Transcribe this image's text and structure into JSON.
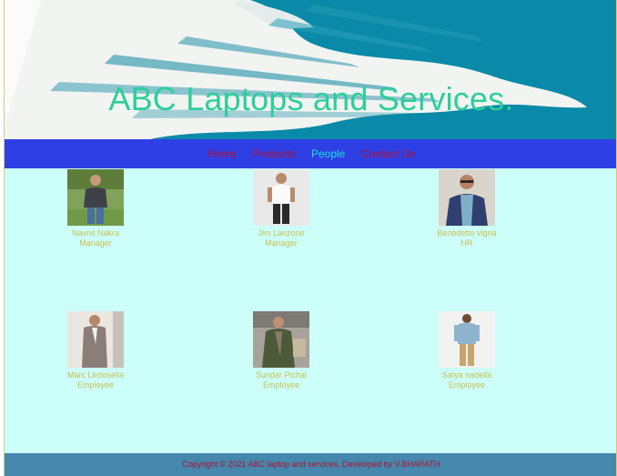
{
  "site": {
    "title": "ABC Laptops and Services."
  },
  "nav": {
    "items": [
      {
        "label": "Home"
      },
      {
        "label": "Products"
      },
      {
        "label": "People"
      },
      {
        "label": "Contact Us"
      }
    ],
    "active": "People"
  },
  "people": [
    {
      "name": "Navnit Nakra",
      "role": "Manager",
      "photo_icon": "person-field-photo"
    },
    {
      "name": "Jim Lanzone",
      "role": "Manager",
      "photo_icon": "person-white-tee-photo"
    },
    {
      "name": "Benedetto vigna",
      "role": "HR",
      "photo_icon": "person-sunglasses-photo"
    },
    {
      "name": "Marc Llistosella",
      "role": "Employee",
      "photo_icon": "person-suit-photo"
    },
    {
      "name": "Sundar Pichai",
      "role": "Employee",
      "photo_icon": "person-jacket-photo"
    },
    {
      "name": "Satya nadella",
      "role": "Employee",
      "photo_icon": "person-denim-photo"
    }
  ],
  "footer": {
    "text": "Copyright © 2021 ABC laptop and services, Developed by V.BHARATH"
  },
  "colors": {
    "banner_teal": "#0a8aa8",
    "title": "#2ccf9a",
    "nav_bg": "#2f3fe6",
    "nav_link": "#b3112a",
    "nav_active": "#19e3d5",
    "page_bg": "#ccfff9",
    "person_text": "#c7c052",
    "footer_bg": "#4587ad",
    "footer_text": "#b0122a"
  }
}
